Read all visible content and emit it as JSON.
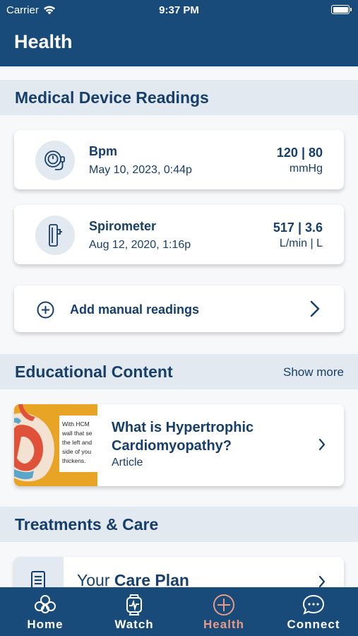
{
  "status_bar": {
    "carrier": "Carrier",
    "time": "9:37 PM"
  },
  "header": {
    "title": "Health"
  },
  "sections": {
    "devices": {
      "title": "Medical Device Readings"
    },
    "education": {
      "title": "Educational Content",
      "show_more": "Show more"
    },
    "treatments": {
      "title": "Treatments & Care"
    }
  },
  "devices": [
    {
      "name": "Bpm",
      "date": "May 10, 2023, 0:44p",
      "value": "120 | 80",
      "unit": "mmHg",
      "icon": "blood-pressure-icon"
    },
    {
      "name": "Spirometer",
      "date": "Aug 12, 2020, 1:16p",
      "value": "517 | 3.6",
      "unit": "L/min | L",
      "icon": "spirometer-icon"
    }
  ],
  "add_manual": {
    "label": "Add manual readings"
  },
  "education_item": {
    "title": "What is Hypertrophic Cardiomyopathy?",
    "type": "Article",
    "thumb_text": [
      "With HCM",
      "wall that se",
      "the left and",
      "side of you",
      "thickens."
    ]
  },
  "care_plan": {
    "prefix": "Your ",
    "bold": "Care Plan"
  },
  "tabs": [
    {
      "label": "Home",
      "icon": "home-knot-icon",
      "active": false
    },
    {
      "label": "Watch",
      "icon": "watch-icon",
      "active": false
    },
    {
      "label": "Health",
      "icon": "plus-circle-icon",
      "active": true
    },
    {
      "label": "Connect",
      "icon": "chat-bubble-icon",
      "active": false
    }
  ],
  "colors": {
    "primary": "#184a7a",
    "text": "#173f6b",
    "section_bg": "#e3e9f0",
    "active_tab": "#e79a85",
    "thumb_bg": "#e8a425"
  }
}
